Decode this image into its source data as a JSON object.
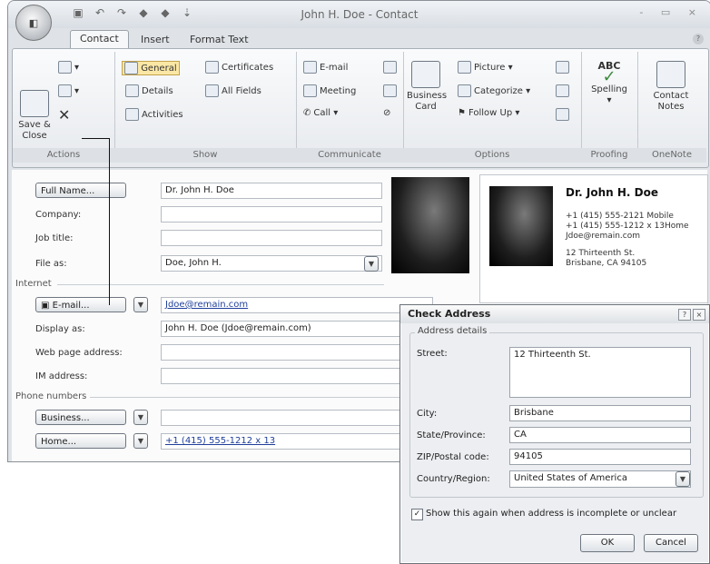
{
  "window": {
    "title": "John H. Doe - Contact",
    "office_button": "Office",
    "qat": [
      "save-icon",
      "undo-icon",
      "redo-icon",
      "previous-icon",
      "next-icon",
      "customize-icon"
    ],
    "controls": "- ▭ ×"
  },
  "tabs": [
    "Contact",
    "Insert",
    "Format Text"
  ],
  "ribbon": {
    "actions": {
      "label": "Actions",
      "save_close": "Save &\nClose"
    },
    "show": {
      "label": "Show",
      "general": "General",
      "certificates": "Certificates",
      "details": "Details",
      "all_fields": "All Fields",
      "activities": "Activities"
    },
    "communicate": {
      "label": "Communicate",
      "email": "E-mail",
      "meeting": "Meeting",
      "call": "Call ▾"
    },
    "options": {
      "label": "Options",
      "business_card": "Business\nCard",
      "picture": "Picture ▾",
      "categorize": "Categorize ▾",
      "follow_up": "Follow Up ▾"
    },
    "proofing": {
      "label": "Proofing",
      "spelling": "Spelling",
      "abc": "ABC"
    },
    "onenote": {
      "label": "OneNote",
      "contact_notes": "Contact\nNotes"
    }
  },
  "form": {
    "full_name_btn": "Full Name...",
    "full_name": "Dr. John H. Doe",
    "company_label": "Company:",
    "company": "",
    "job_title_label": "Job title:",
    "job_title": "",
    "file_as_label": "File as:",
    "file_as": "Doe, John H.",
    "internet_label": "Internet",
    "email_btn": "E-mail...",
    "email": "Jdoe@remain.com",
    "display_as_label": "Display as:",
    "display_as": "John H. Doe (Jdoe@remain.com)",
    "web_label": "Web page address:",
    "web": "",
    "im_label": "IM address:",
    "im": "",
    "phone_label": "Phone numbers",
    "business_btn": "Business...",
    "business_phone": "",
    "home_btn": "Home...",
    "home_phone": "+1 (415) 555-1212 x 13"
  },
  "card": {
    "name": "Dr. John H. Doe",
    "line1": "+1 (415) 555-2121 Mobile",
    "line2": "+1 (415) 555-1212 x 13Home",
    "line3": "Jdoe@remain.com",
    "line4": "12 Thirteenth St.",
    "line5": "Brisbane, CA  94105"
  },
  "dialog": {
    "title": "Check Address",
    "group": "Address details",
    "street_label": "Street:",
    "street": "12 Thirteenth St.",
    "city_label": "City:",
    "city": "Brisbane",
    "state_label": "State/Province:",
    "state": "CA",
    "zip_label": "ZIP/Postal code:",
    "zip": "94105",
    "country_label": "Country/Region:",
    "country": "United States of America",
    "show_again": "Show this again when address is incomplete or unclear",
    "ok": "OK",
    "cancel": "Cancel"
  }
}
